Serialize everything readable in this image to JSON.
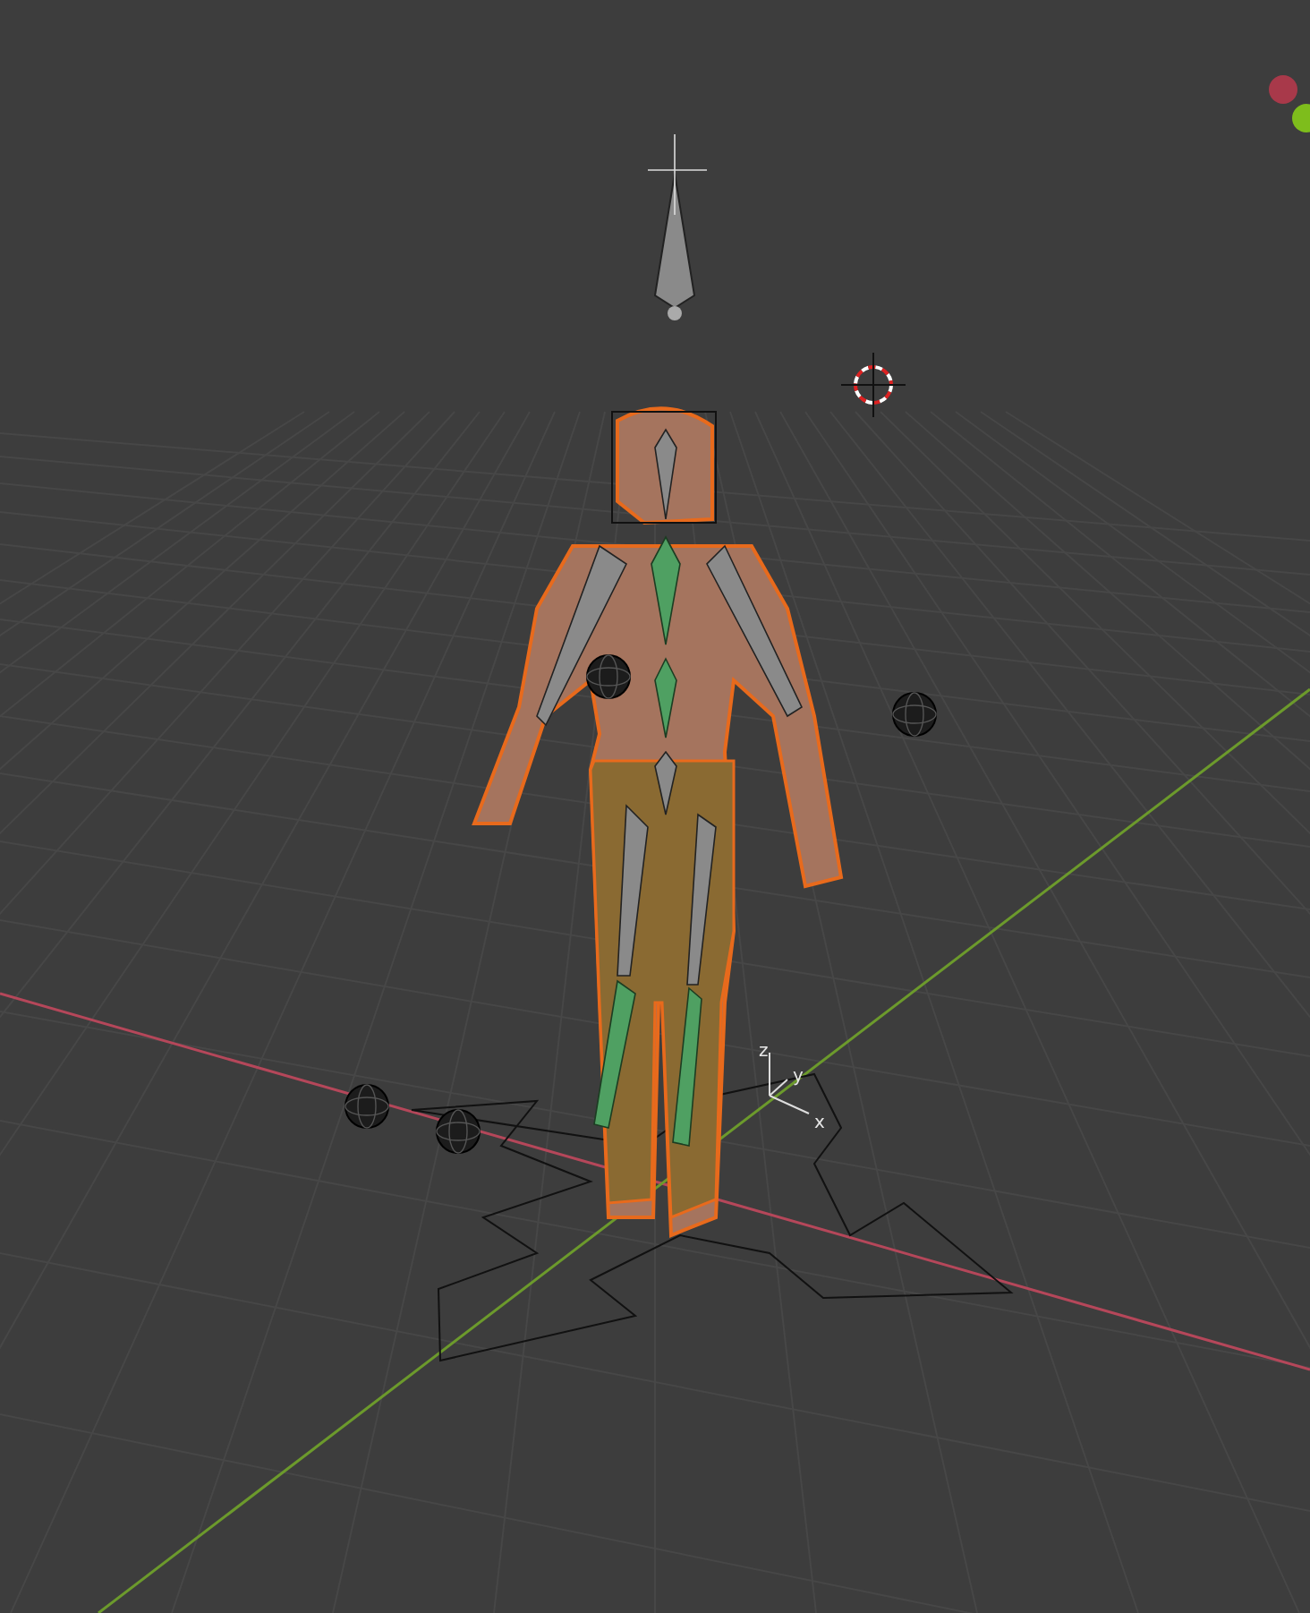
{
  "viewport": {
    "kind": "perspective",
    "axes": [
      {
        "kind": "lateral",
        "color": "#b5475a"
      },
      {
        "kind": "forward",
        "color": "#6c9a2c"
      }
    ],
    "widget_labels": [
      "z",
      "y",
      "x"
    ]
  }
}
